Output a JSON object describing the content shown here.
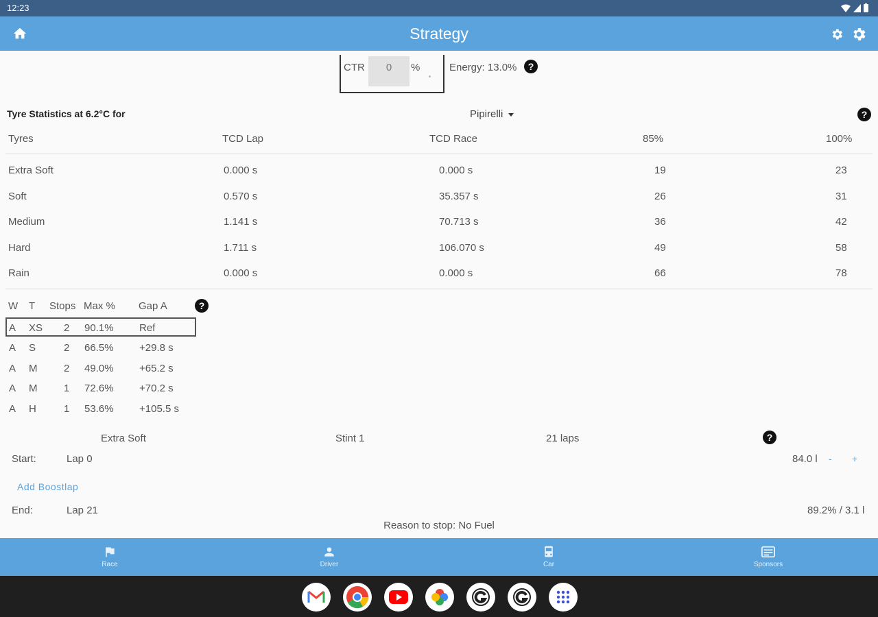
{
  "status": {
    "time": "12:23"
  },
  "appbar": {
    "title": "Strategy"
  },
  "ctr": {
    "label": "CTR",
    "value": "0",
    "unit": "%",
    "energy": "Energy: 13.0%"
  },
  "tyre_stats": {
    "title": "Tyre Statistics at 6.2°C for",
    "brand": "Pipirelli",
    "headers": [
      "Tyres",
      "TCD Lap",
      "TCD Race",
      "85%",
      "100%"
    ],
    "rows": [
      [
        "Extra Soft",
        "0.000 s",
        "0.000 s",
        "19",
        "23"
      ],
      [
        "Soft",
        "0.570 s",
        "35.357 s",
        "26",
        "31"
      ],
      [
        "Medium",
        "1.141 s",
        "70.713 s",
        "36",
        "42"
      ],
      [
        "Hard",
        "1.711 s",
        "106.070 s",
        "49",
        "58"
      ],
      [
        "Rain",
        "0.000 s",
        "0.000 s",
        "66",
        "78"
      ]
    ]
  },
  "strategies": {
    "headers": [
      "W",
      "T",
      "Stops",
      "Max %",
      "Gap A"
    ],
    "rows": [
      [
        "A",
        "XS",
        "2",
        "90.1%",
        "Ref"
      ],
      [
        "A",
        "S",
        "2",
        "66.5%",
        "+29.8 s"
      ],
      [
        "A",
        "M",
        "2",
        "49.0%",
        "+65.2 s"
      ],
      [
        "A",
        "M",
        "1",
        "72.6%",
        "+70.2 s"
      ],
      [
        "A",
        "H",
        "1",
        "53.6%",
        "+105.5 s"
      ]
    ]
  },
  "stint": {
    "tyre": "Extra Soft",
    "name": "Stint 1",
    "laps": "21 laps",
    "start_label": "Start:",
    "start_lap": "Lap 0",
    "fuel": "84.0 l",
    "minus": "-",
    "plus": "+",
    "add_boost": "Add Boostlap",
    "end_label": "End:",
    "end_lap": "Lap 21",
    "end_stats": "89.2% / 3.1 l",
    "reason": "Reason to stop: No Fuel"
  },
  "nav": [
    {
      "label": "Race",
      "icon": "flag-icon"
    },
    {
      "label": "Driver",
      "icon": "person-icon"
    },
    {
      "label": "Car",
      "icon": "car-icon"
    },
    {
      "label": "Sponsors",
      "icon": "sponsors-icon"
    }
  ],
  "help_glyph": "?"
}
